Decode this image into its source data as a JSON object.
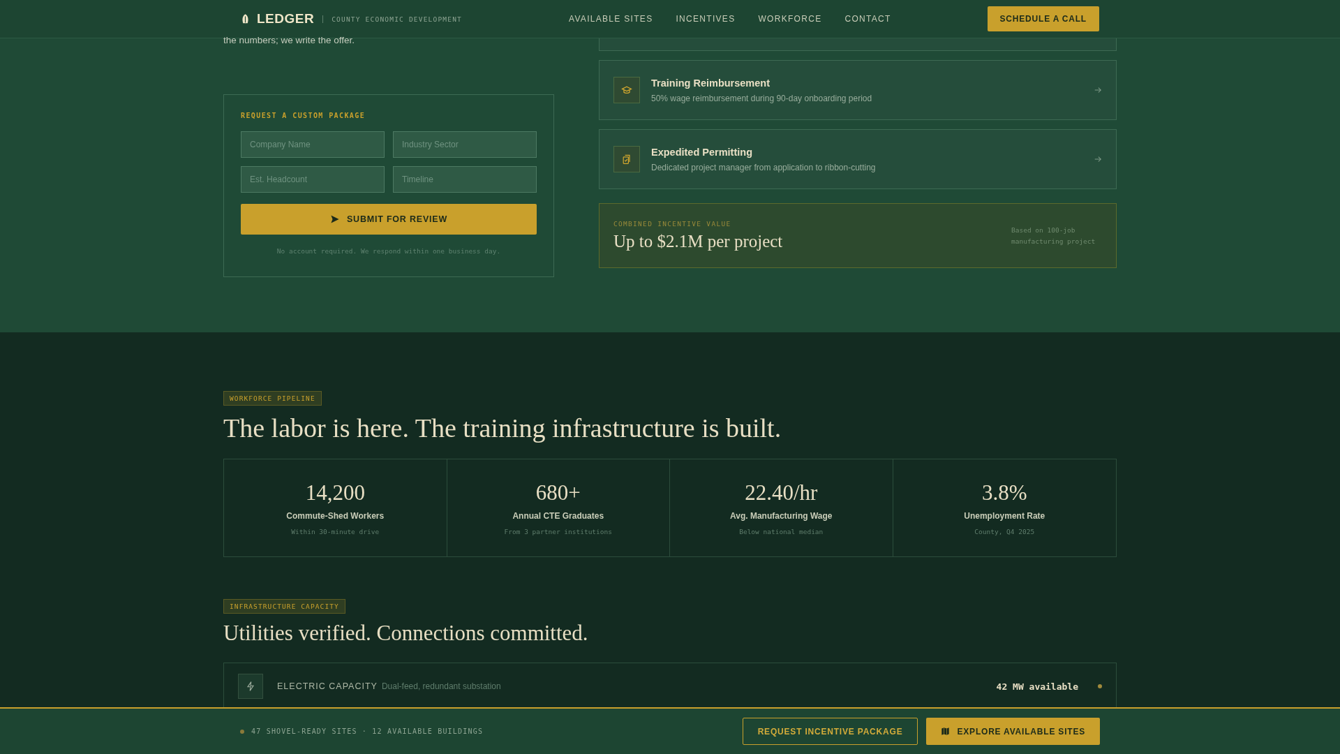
{
  "header": {
    "logo": "LEDGER",
    "tagline": "COUNTY ECONOMIC DEVELOPMENT",
    "nav": [
      "AVAILABLE SITES",
      "INCENTIVES",
      "WORKFORCE",
      "CONTACT"
    ],
    "cta": "SCHEDULE A CALL"
  },
  "intro": {
    "text": "the numbers; we write the offer."
  },
  "form": {
    "title": "REQUEST A CUSTOM PACKAGE",
    "fields": [
      {
        "placeholder": "Company Name"
      },
      {
        "placeholder": "Industry Sector"
      },
      {
        "placeholder": "Est. Headcount"
      },
      {
        "placeholder": "Timeline"
      }
    ],
    "submit": "SUBMIT FOR REVIEW",
    "note": "No account required. We respond within one business day."
  },
  "incentives": [
    {
      "kind": "graduation",
      "title": "Training Reimbursement",
      "description": "50% wage reimbursement during 90-day onboarding period"
    },
    {
      "kind": "clipboard",
      "title": "Expedited Permitting",
      "description": "Dedicated project manager from application to ribbon-cutting"
    }
  ],
  "combined": {
    "label": "COMBINED INCENTIVE VALUE",
    "value": "Up to $2.1M per project",
    "note": "Based on 100-job manufacturing project"
  },
  "workforce": {
    "tag": "WORKFORCE PIPELINE",
    "heading": "The labor is here. The training infrastructure is built.",
    "stats": [
      {
        "value": "14,200",
        "label": "Commute-Shed Workers",
        "sub": "Within 30-minute drive"
      },
      {
        "value": "680+",
        "label": "Annual CTE Graduates",
        "sub": "From 3 partner institutions"
      },
      {
        "value": "22.40/hr",
        "label": "Avg. Manufacturing Wage",
        "sub": "Below national median"
      },
      {
        "value": "3.8%",
        "label": "Unemployment Rate",
        "sub": "County, Q4 2025"
      }
    ]
  },
  "infrastructure": {
    "tag": "INFRASTRUCTURE CAPACITY",
    "heading": "Utilities verified. Connections committed.",
    "rows": [
      {
        "name": "ELECTRIC CAPACITY",
        "description": "Dual-feed, redundant substation",
        "value": "42 MW available",
        "color": "#a08a3c"
      }
    ]
  },
  "status_bar": {
    "color": "#8a7a3a",
    "text": "47 SHOVEL-READY SITES · 12 AVAILABLE BUILDINGS",
    "buttons": [
      {
        "kind": "outline",
        "label": "REQUEST INCENTIVE PACKAGE"
      },
      {
        "kind": "primary",
        "label": "EXPLORE AVAILABLE SITES"
      }
    ]
  }
}
